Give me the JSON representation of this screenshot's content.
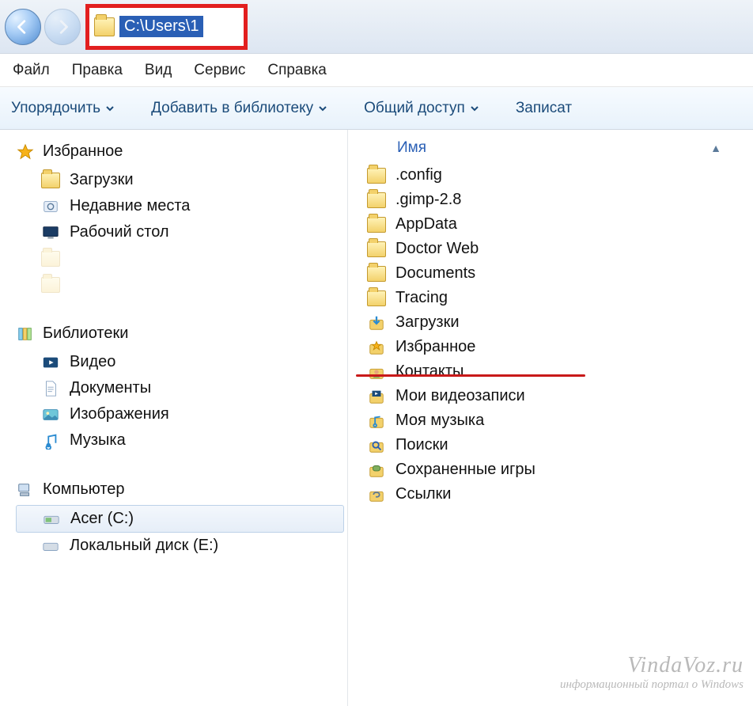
{
  "address_bar": {
    "path": "C:\\Users\\1"
  },
  "menubar": {
    "file": "Файл",
    "edit": "Правка",
    "view": "Вид",
    "tools": "Сервис",
    "help": "Справка"
  },
  "toolbar": {
    "organize": "Упорядочить",
    "addtolib": "Добавить в библиотеку",
    "share": "Общий доступ",
    "burn": "Записат"
  },
  "column_header": {
    "name": "Имя"
  },
  "sidebar": {
    "favorites": {
      "label": "Избранное",
      "items": [
        {
          "label": "Загрузки"
        },
        {
          "label": "Недавние места"
        },
        {
          "label": "Рабочий стол"
        }
      ]
    },
    "libraries": {
      "label": "Библиотеки",
      "items": [
        {
          "label": "Видео"
        },
        {
          "label": "Документы"
        },
        {
          "label": "Изображения"
        },
        {
          "label": "Музыка"
        }
      ]
    },
    "computer": {
      "label": "Компьютер",
      "items": [
        {
          "label": "Acer (C:)",
          "selected": true
        },
        {
          "label": "Локальный диск (E:)"
        }
      ]
    }
  },
  "files": [
    {
      "label": ".config",
      "icon": "folder"
    },
    {
      "label": ".gimp-2.8",
      "icon": "folder"
    },
    {
      "label": "AppData",
      "icon": "folder"
    },
    {
      "label": "Doctor Web",
      "icon": "folder"
    },
    {
      "label": "Documents",
      "icon": "folder"
    },
    {
      "label": "Tracing",
      "icon": "folder"
    },
    {
      "label": "Загрузки",
      "icon": "downloads"
    },
    {
      "label": "Избранное",
      "icon": "favorites"
    },
    {
      "label": "Контакты",
      "icon": "contacts"
    },
    {
      "label": "Мои видеозаписи",
      "icon": "video"
    },
    {
      "label": "Моя музыка",
      "icon": "music"
    },
    {
      "label": "Поиски",
      "icon": "search"
    },
    {
      "label": "Сохраненные игры",
      "icon": "games"
    },
    {
      "label": "Ссылки",
      "icon": "links"
    }
  ],
  "watermark": {
    "line1": "VindaVoz.ru",
    "line2": "информационный портал о Windows"
  }
}
